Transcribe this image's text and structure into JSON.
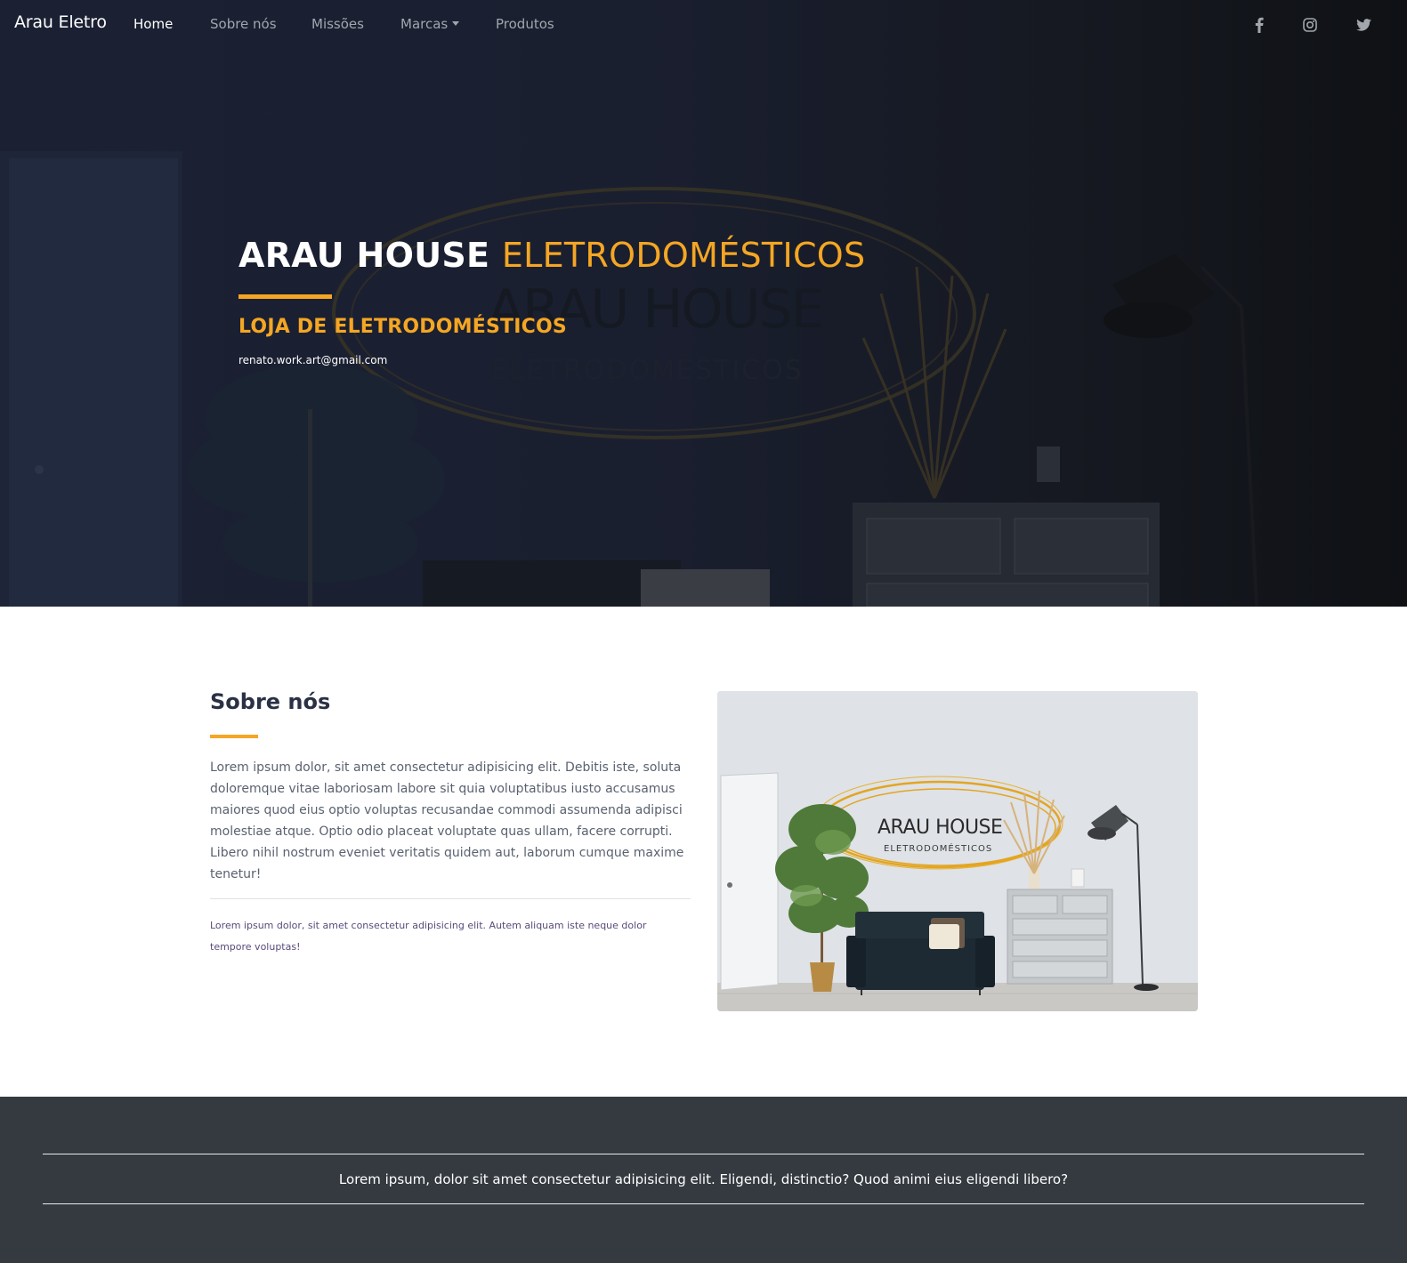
{
  "navbar": {
    "brand": "Arau Eletro",
    "links": [
      {
        "label": "Home",
        "active": true
      },
      {
        "label": "Sobre nós",
        "active": false
      },
      {
        "label": "Missões",
        "active": false
      },
      {
        "label": "Marcas",
        "active": false,
        "dropdown": true
      },
      {
        "label": "Produtos",
        "active": false
      }
    ],
    "social": [
      "facebook-icon",
      "instagram-icon",
      "twitter-icon"
    ]
  },
  "hero": {
    "title_main": "ARAU HOUSE",
    "title_accent": "ELETRODOMÉSTICOS",
    "subtitle": "LOJA DE ELETRODOMÉSTICOS",
    "email": "renato.work.art@gmail.com",
    "logo_text": "ARAU HOUSE",
    "logo_subtext": "ELETRODOMÉSTICOS"
  },
  "about": {
    "title": "Sobre nós",
    "paragraph": "Lorem ipsum dolor, sit amet consectetur adipisicing elit. Debitis iste, soluta doloremque vitae laboriosam labore sit quia voluptatibus iusto accusamus maiores quod eius optio voluptas recusandae commodi assumenda adipisci molestiae atque. Optio odio placeat voluptate quas ullam, facere corrupti. Libero nihil nostrum eveniet veritatis quidem aut, laborum cumque maxime tenetur!",
    "small_text": "Lorem ipsum dolor, sit amet consectetur adipisicing elit. Autem aliquam iste neque dolor tempore voluptas!",
    "image_logo_text": "ARAU HOUSE",
    "image_logo_subtext": "ELETRODOMÉSTICOS"
  },
  "footer": {
    "text": "Lorem ipsum, dolor sit amet consectetur adipisicing elit. Eligendi, distinctio? Quod animi eius eligendi libero?"
  },
  "colors": {
    "accent": "#f5a623",
    "hero_bg": "#1b2133",
    "footer_bg": "#343a40",
    "heading": "#2a3144"
  }
}
